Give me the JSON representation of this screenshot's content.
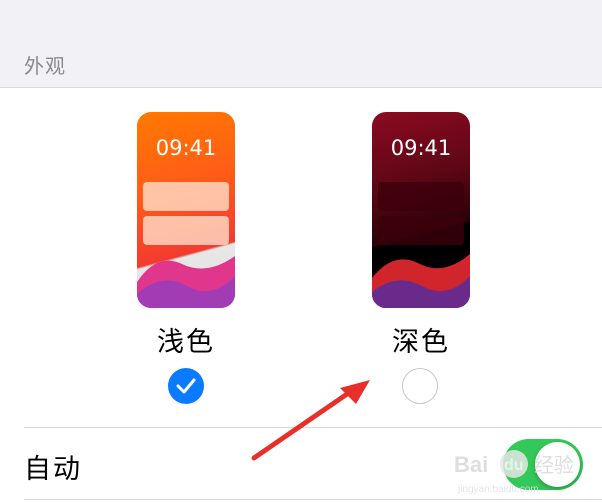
{
  "appearance": {
    "section_title": "外观",
    "light_option": {
      "time": "09:41",
      "label": "浅色",
      "selected": true
    },
    "dark_option": {
      "time": "09:41",
      "label": "深色",
      "selected": false
    }
  },
  "automatic": {
    "label": "自动",
    "toggle_on": true
  },
  "colors": {
    "accent": "#0a7aff",
    "toggle_green": "#34c759",
    "annotation_red": "#e8302a"
  },
  "watermark": {
    "text": "Bai du 经验",
    "sub": "jingyan.baidu.com"
  }
}
